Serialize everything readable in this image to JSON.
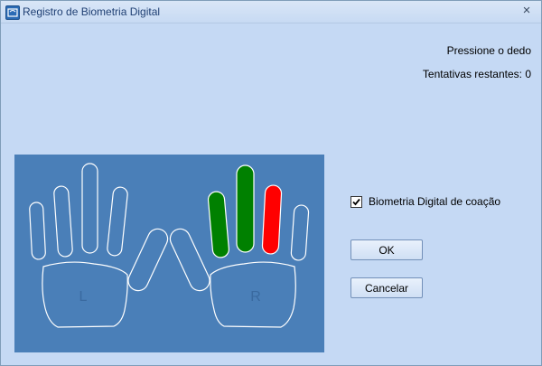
{
  "window": {
    "title": "Registro de Biometria Digital",
    "close_symbol": "×"
  },
  "status": {
    "prompt": "Pressione o dedo",
    "attempts_label": "Tentativas restantes: 0"
  },
  "hands": {
    "left_label": "L",
    "right_label": "R",
    "colors": {
      "background": "#4a7fb8",
      "outline": "#ffffff",
      "enrolled": "#008000",
      "failed": "#ff0000"
    },
    "fingers": [
      {
        "name": "left-little",
        "state": "empty"
      },
      {
        "name": "left-ring",
        "state": "empty"
      },
      {
        "name": "left-middle",
        "state": "empty"
      },
      {
        "name": "left-index",
        "state": "empty"
      },
      {
        "name": "left-thumb",
        "state": "empty"
      },
      {
        "name": "right-thumb",
        "state": "empty"
      },
      {
        "name": "right-index",
        "state": "enrolled"
      },
      {
        "name": "right-middle",
        "state": "enrolled"
      },
      {
        "name": "right-ring",
        "state": "failed"
      },
      {
        "name": "right-little",
        "state": "empty"
      }
    ]
  },
  "coercion": {
    "label": "Biometria Digital de coação",
    "checked": true
  },
  "buttons": {
    "ok": "OK",
    "cancel": "Cancelar"
  }
}
